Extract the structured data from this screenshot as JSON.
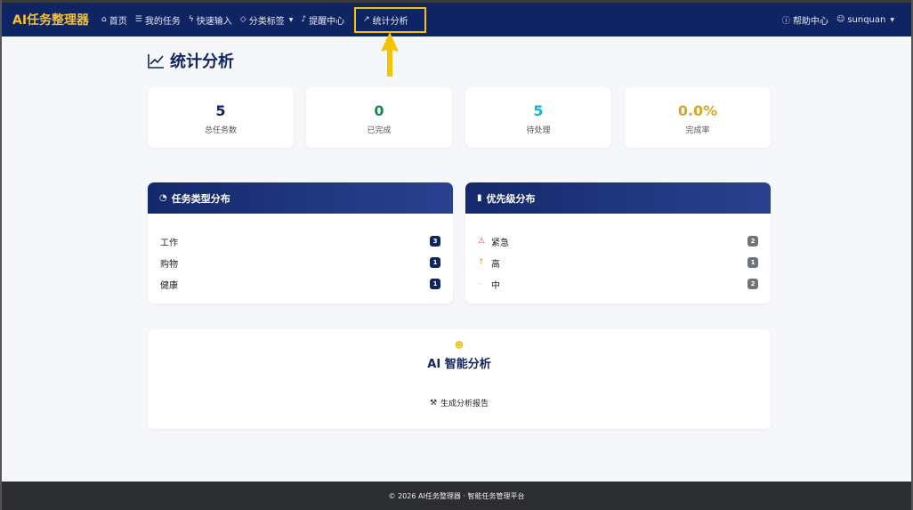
{
  "navbar": {
    "brand": "AI任务整理器",
    "items": [
      {
        "icon": "home-icon",
        "glyph": "⌂",
        "label": "首页"
      },
      {
        "icon": "list-icon",
        "glyph": "☰",
        "label": "我的任务"
      },
      {
        "icon": "lightning-icon",
        "glyph": "ϟ",
        "label": "快速输入"
      },
      {
        "icon": "tag-icon",
        "glyph": "◇",
        "label": "分类标签"
      },
      {
        "icon": "bell-icon",
        "glyph": "♪",
        "label": "提醒中心"
      },
      {
        "icon": "chart-line-icon",
        "glyph": "↗",
        "label": "统计分析"
      }
    ],
    "help": "帮助中心",
    "user": "sunquan",
    "highlight_color": "#f5c400"
  },
  "page": {
    "title": "统计分析"
  },
  "stats": [
    {
      "value": "5",
      "label": "总任务数",
      "color": "#0f2462"
    },
    {
      "value": "0",
      "label": "已完成",
      "color": "#198754"
    },
    {
      "value": "5",
      "label": "待处理",
      "color": "#13b5d4"
    },
    {
      "value": "0.0%",
      "label": "完成率",
      "color": "#d4a62a"
    }
  ],
  "type_panel": {
    "title": "任务类型分布",
    "rows": [
      {
        "label": "工作",
        "count": "3"
      },
      {
        "label": "购物",
        "count": "1"
      },
      {
        "label": "健康",
        "count": "1"
      }
    ]
  },
  "priority_panel": {
    "title": "优先级分布",
    "rows": [
      {
        "icon": "warning-icon",
        "glyph": "⚠",
        "color": "#dc3545",
        "label": "紧急",
        "count": "2"
      },
      {
        "icon": "arrow-up-icon",
        "glyph": "↑",
        "color": "#c8a43a",
        "label": "高",
        "count": "1"
      },
      {
        "icon": "dash-icon",
        "glyph": "–",
        "color": "#cccccc",
        "label": "中",
        "count": "2"
      }
    ]
  },
  "ai": {
    "title": "AI 智能分析",
    "button": "生成分析报告"
  },
  "footer": {
    "text": "© 2026 AI任务整理器 · 智能任务管理平台"
  }
}
